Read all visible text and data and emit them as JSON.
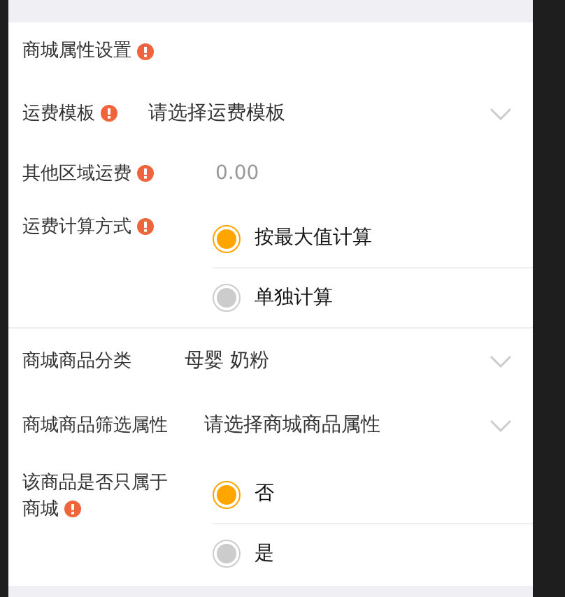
{
  "section_title": {
    "label": "商城属性设置",
    "required": true
  },
  "fields": [
    {
      "kind": "select",
      "label": "运费模板",
      "required": true,
      "value": "请选择运费模板"
    },
    {
      "kind": "input",
      "label": "其他区域运费",
      "required": true,
      "placeholder": "0.00"
    },
    {
      "kind": "radio",
      "label": "运费计算方式",
      "required": true,
      "options": [
        {
          "label": "按最大值计算",
          "selected": true
        },
        {
          "label": "单独计算",
          "selected": false
        }
      ]
    },
    {
      "kind": "select",
      "label": "商城商品分类",
      "required": false,
      "value": "母婴 奶粉"
    },
    {
      "kind": "select",
      "label": "商城商品筛选属性",
      "required": false,
      "value": "请选择商城商品属性"
    },
    {
      "kind": "radio",
      "label": "该商品是否只属于商城",
      "required": true,
      "options": [
        {
          "label": "否",
          "selected": true
        },
        {
          "label": "是",
          "selected": false
        }
      ]
    }
  ]
}
